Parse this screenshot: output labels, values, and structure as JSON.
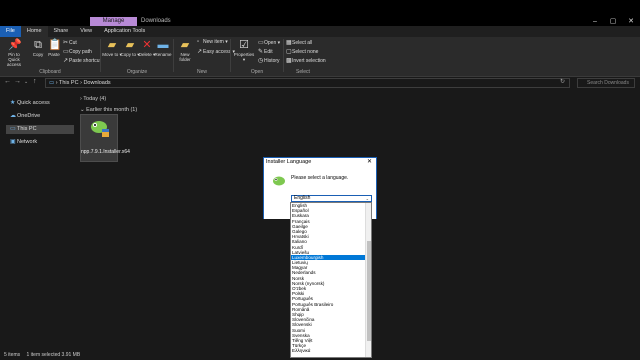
{
  "window": {
    "context_tab": "Manage",
    "title": "Downloads",
    "controls": [
      "–",
      "▢",
      "✕"
    ]
  },
  "ribbon_tabs": [
    "File",
    "Home",
    "Share",
    "View",
    "Application Tools"
  ],
  "ribbon": {
    "clipboard": {
      "pin_label": "Pin to Quick access",
      "copy_label": "Copy",
      "paste_label": "Paste",
      "cut_label": "Cut",
      "copy_path_label": "Copy path",
      "paste_shortcut_label": "Paste shortcut",
      "group_label": "Clipboard"
    },
    "organize": {
      "move_to_label": "Move to ▾",
      "copy_to_label": "Copy to ▾",
      "delete_label": "Delete ▾",
      "rename_label": "Rename",
      "group_label": "Organize"
    },
    "new": {
      "new_folder_label": "New folder",
      "new_item_label": "New item ▾",
      "easy_access_label": "Easy access ▾",
      "group_label": "New"
    },
    "open": {
      "properties_label": "Properties ▾",
      "open_label": "Open ▾",
      "edit_label": "Edit",
      "history_label": "History",
      "group_label": "Open"
    },
    "select": {
      "select_all_label": "Select all",
      "select_none_label": "Select none",
      "invert_label": "Invert selection",
      "group_label": "Select"
    }
  },
  "address": {
    "path": "› This PC › Downloads",
    "search_placeholder": "Search Downloads"
  },
  "sidebar": {
    "items": [
      {
        "label": "Quick access",
        "icon": "star-icon"
      },
      {
        "label": "OneDrive",
        "icon": "cloud-icon"
      },
      {
        "label": "This PC",
        "icon": "computer-icon"
      },
      {
        "label": "Network",
        "icon": "network-icon"
      }
    ]
  },
  "content": {
    "groups": [
      "Today (4)",
      "Earlier this month (1)"
    ],
    "file_name": "npp.7.9.1.Installer.x64"
  },
  "status": {
    "items": "5 items",
    "selected": "1 item selected  3.91 MB"
  },
  "dialog": {
    "title": "Installer Language",
    "prompt": "Please select a language.",
    "selected_value": "English",
    "highlighted": "Luxembourgish",
    "options": [
      "English",
      "Español",
      "Euskara",
      "Français",
      "Gaeilge",
      "Galego",
      "Hrvatski",
      "Italiano",
      "Kurdî",
      "Latviešu",
      "Luxembourgish",
      "Lietuvių",
      "Magyar",
      "Nederlands",
      "Norsk",
      "Norsk (nynorsk)",
      "O'zbek",
      "Polski",
      "Português",
      "Português Brasileiro",
      "Română",
      "Shqip",
      "Slovenčina",
      "Slovenski",
      "Suomi",
      "Svenska",
      "Tiếng Việt",
      "Türkçe",
      "Ελληνικά"
    ]
  }
}
